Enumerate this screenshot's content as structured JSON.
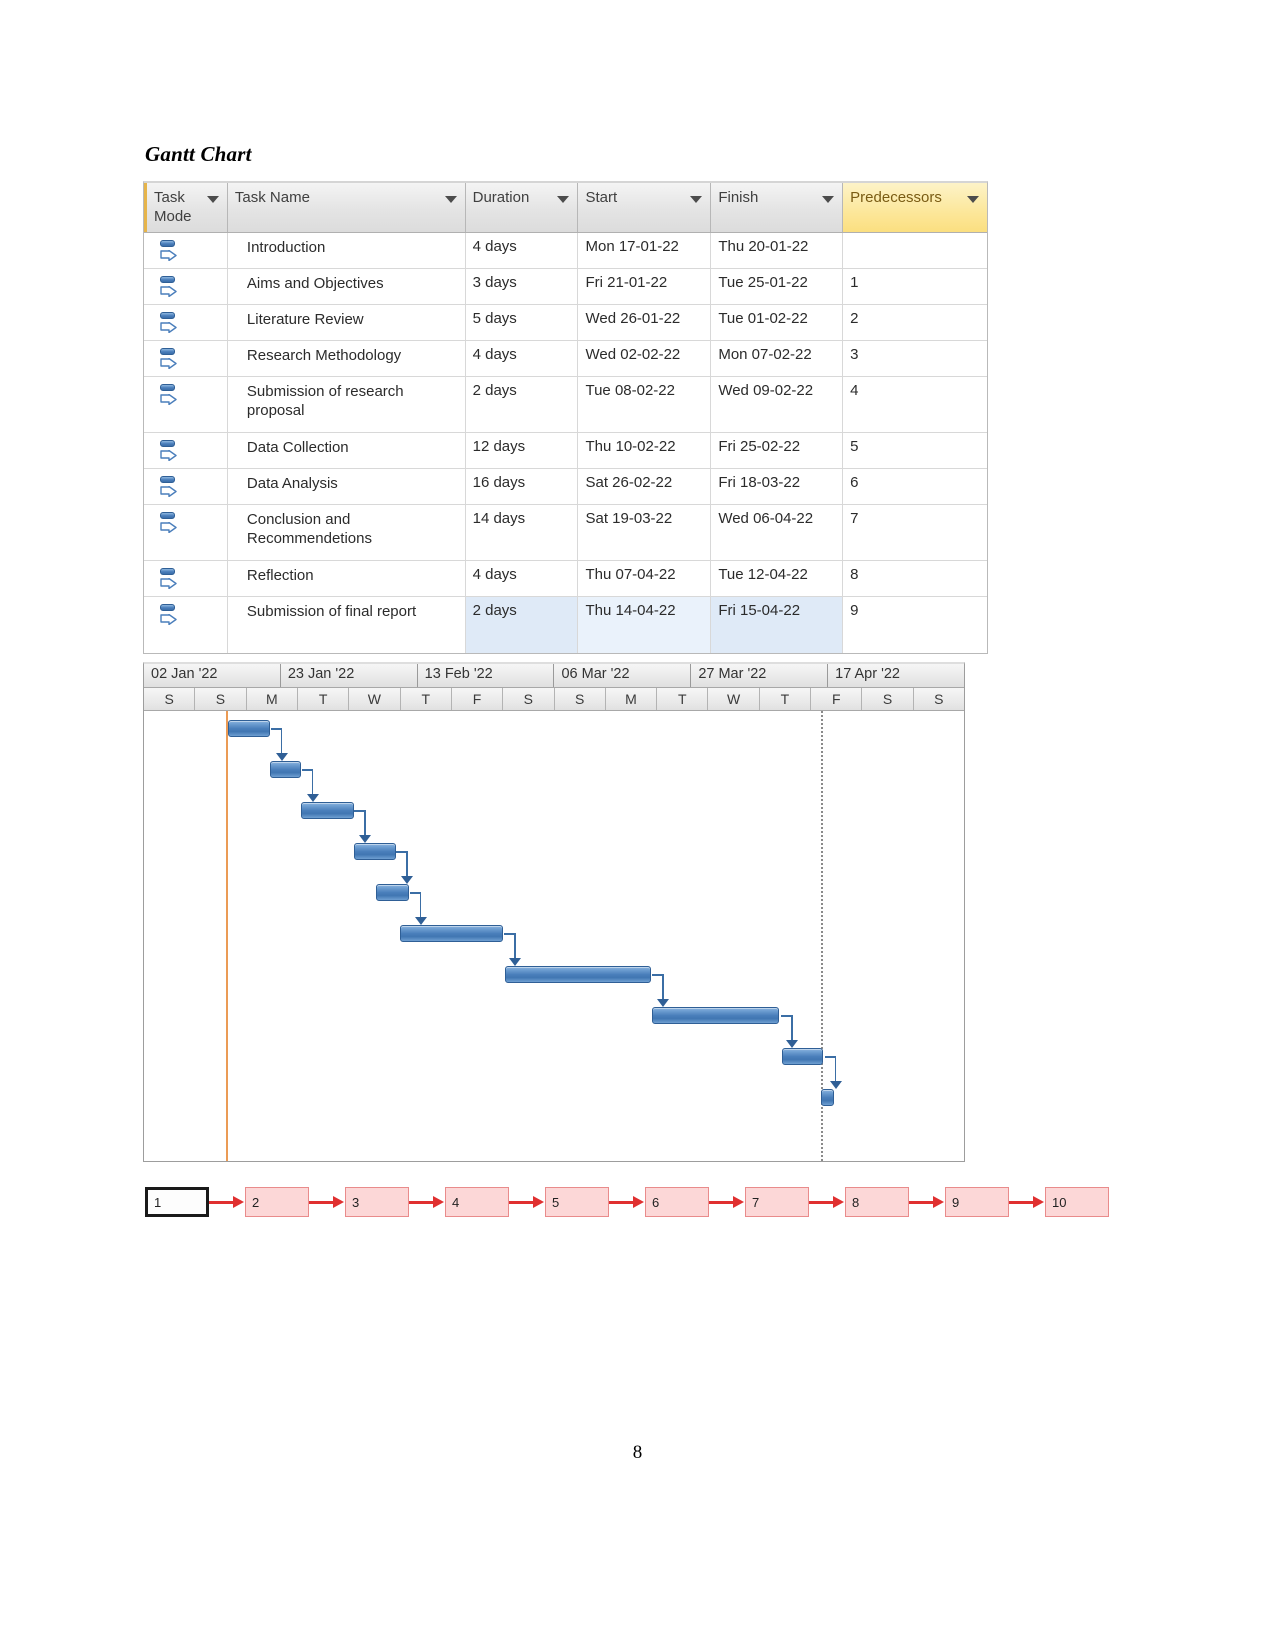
{
  "page": {
    "title": "Gantt Chart",
    "page_number": "8"
  },
  "table": {
    "columns": [
      {
        "key": "mode",
        "label": "Task Mode",
        "has_filter": true,
        "highlight": false
      },
      {
        "key": "name",
        "label": "Task Name",
        "has_filter": true,
        "highlight": false
      },
      {
        "key": "dur",
        "label": "Duration",
        "has_filter": true,
        "highlight": false
      },
      {
        "key": "start",
        "label": "Start",
        "has_filter": true,
        "highlight": false
      },
      {
        "key": "fin",
        "label": "Finish",
        "has_filter": true,
        "highlight": false
      },
      {
        "key": "pred",
        "label": "Predecessors",
        "has_filter": true,
        "highlight": true
      }
    ],
    "rows": [
      {
        "mode_icon": "auto-schedule-icon",
        "name": "Introduction",
        "duration": "4 days",
        "start": "Mon 17-01-22",
        "finish": "Thu 20-01-22",
        "predecessors": "",
        "tall": false,
        "selected": false
      },
      {
        "mode_icon": "auto-schedule-icon",
        "name": "Aims and Objectives",
        "duration": "3 days",
        "start": "Fri 21-01-22",
        "finish": "Tue 25-01-22",
        "predecessors": "1",
        "tall": false,
        "selected": false
      },
      {
        "mode_icon": "auto-schedule-icon",
        "name": "Literature Review",
        "duration": "5 days",
        "start": "Wed 26-01-22",
        "finish": "Tue 01-02-22",
        "predecessors": "2",
        "tall": false,
        "selected": false
      },
      {
        "mode_icon": "auto-schedule-icon",
        "name": "Research Methodology",
        "duration": "4 days",
        "start": "Wed 02-02-22",
        "finish": "Mon 07-02-22",
        "predecessors": "3",
        "tall": false,
        "selected": false
      },
      {
        "mode_icon": "auto-schedule-icon",
        "name": "Submission of research proposal",
        "duration": "2 days",
        "start": "Tue 08-02-22",
        "finish": "Wed 09-02-22",
        "predecessors": "4",
        "tall": true,
        "selected": false
      },
      {
        "mode_icon": "auto-schedule-icon",
        "name": "Data Collection",
        "duration": "12 days",
        "start": "Thu 10-02-22",
        "finish": "Fri 25-02-22",
        "predecessors": "5",
        "tall": false,
        "selected": false
      },
      {
        "mode_icon": "auto-schedule-icon",
        "name": "Data Analysis",
        "duration": "16 days",
        "start": "Sat 26-02-22",
        "finish": "Fri 18-03-22",
        "predecessors": "6",
        "tall": false,
        "selected": false
      },
      {
        "mode_icon": "auto-schedule-icon",
        "name": "Conclusion and Recommendetions",
        "duration": "14 days",
        "start": "Sat 19-03-22",
        "finish": "Wed 06-04-22",
        "predecessors": "7",
        "tall": true,
        "selected": false
      },
      {
        "mode_icon": "auto-schedule-icon",
        "name": "Reflection",
        "duration": "4 days",
        "start": "Thu 07-04-22",
        "finish": "Tue 12-04-22",
        "predecessors": "8",
        "tall": false,
        "selected": false
      },
      {
        "mode_icon": "auto-schedule-icon",
        "name": "Submission of final report",
        "duration": "2 days",
        "start": "Thu 14-04-22",
        "finish": "Fri 15-04-22",
        "predecessors": "9",
        "tall": true,
        "selected": true
      }
    ]
  },
  "chart_data": {
    "type": "bar",
    "title": "Gantt Chart",
    "xlabel": "",
    "ylabel": "",
    "timeline": {
      "week_headers": [
        "02 Jan '22",
        "23 Jan '22",
        "13 Feb '22",
        "06 Mar '22",
        "27 Mar '22",
        "17 Apr '22"
      ],
      "day_headers": [
        "S",
        "S",
        "M",
        "T",
        "W",
        "T",
        "F",
        "S",
        "S",
        "M",
        "T",
        "W",
        "T",
        "F",
        "S",
        "S"
      ],
      "range_start": "02 Jan '22",
      "range_end": "23 Apr '22",
      "today_line_color": "#eb9b55",
      "status_line_color": "#8a8a8a"
    },
    "categories": [
      "Introduction",
      "Aims and Objectives",
      "Literature Review",
      "Research Methodology",
      "Submission of research proposal",
      "Data Collection",
      "Data Analysis",
      "Conclusion and Recommendetions",
      "Reflection",
      "Submission of final report"
    ],
    "values": [
      4,
      3,
      5,
      4,
      2,
      12,
      16,
      14,
      4,
      2
    ],
    "ylabel_unit": "days",
    "bars": [
      {
        "task": "Introduction",
        "start": "Mon 17-01-22",
        "finish": "Thu 20-01-22",
        "duration_days": 4,
        "left_pct": 10.2,
        "width_pct": 5.2,
        "row": 0
      },
      {
        "task": "Aims and Objectives",
        "start": "Fri 21-01-22",
        "finish": "Tue 25-01-22",
        "duration_days": 3,
        "left_pct": 15.4,
        "width_pct": 3.8,
        "row": 1
      },
      {
        "task": "Literature Review",
        "start": "Wed 26-01-22",
        "finish": "Tue 01-02-22",
        "duration_days": 5,
        "left_pct": 19.2,
        "width_pct": 6.4,
        "row": 2
      },
      {
        "task": "Research Methodology",
        "start": "Wed 02-02-22",
        "finish": "Mon 07-02-22",
        "duration_days": 4,
        "left_pct": 25.6,
        "width_pct": 5.1,
        "row": 3
      },
      {
        "task": "Submission of research proposal",
        "start": "Tue 08-02-22",
        "finish": "Wed 09-02-22",
        "duration_days": 2,
        "left_pct": 28.3,
        "width_pct": 4.0,
        "row": 4
      },
      {
        "task": "Data Collection",
        "start": "Thu 10-02-22",
        "finish": "Fri 25-02-22",
        "duration_days": 12,
        "left_pct": 31.2,
        "width_pct": 12.6,
        "row": 5
      },
      {
        "task": "Data Analysis",
        "start": "Sat 26-02-22",
        "finish": "Fri 18-03-22",
        "duration_days": 16,
        "left_pct": 44.0,
        "width_pct": 17.8,
        "row": 6
      },
      {
        "task": "Conclusion and Recommendetions",
        "start": "Sat 19-03-22",
        "finish": "Wed 06-04-22",
        "duration_days": 14,
        "left_pct": 62.0,
        "width_pct": 15.5,
        "row": 7
      },
      {
        "task": "Reflection",
        "start": "Thu 07-04-22",
        "finish": "Tue 12-04-22",
        "duration_days": 4,
        "left_pct": 77.8,
        "width_pct": 5.0,
        "row": 8
      },
      {
        "task": "Submission of final report",
        "start": "Thu 14-04-22",
        "finish": "Fri 15-04-22",
        "duration_days": 2,
        "left_pct": 82.5,
        "width_pct": 1.6,
        "row": 9
      }
    ],
    "dependencies": [
      {
        "from": "Introduction",
        "to": "Aims and Objectives",
        "type": "FS"
      },
      {
        "from": "Aims and Objectives",
        "to": "Literature Review",
        "type": "FS"
      },
      {
        "from": "Literature Review",
        "to": "Research Methodology",
        "type": "FS"
      },
      {
        "from": "Research Methodology",
        "to": "Submission of research proposal",
        "type": "FS"
      },
      {
        "from": "Submission of research proposal",
        "to": "Data Collection",
        "type": "FS"
      },
      {
        "from": "Data Collection",
        "to": "Data Analysis",
        "type": "FS"
      },
      {
        "from": "Data Analysis",
        "to": "Conclusion and Recommendetions",
        "type": "FS"
      },
      {
        "from": "Conclusion and Recommendetions",
        "to": "Reflection",
        "type": "FS"
      },
      {
        "from": "Reflection",
        "to": "Submission of final report",
        "type": "FS"
      }
    ],
    "bar_color": "#4a7fbb",
    "bar_border_color": "#2f5f96",
    "link_color": "#3b6ea5"
  },
  "flow": {
    "boxes": [
      {
        "label": "1",
        "selected": true
      },
      {
        "label": "2",
        "selected": false
      },
      {
        "label": "3",
        "selected": false
      },
      {
        "label": "4",
        "selected": false
      },
      {
        "label": "5",
        "selected": false
      },
      {
        "label": "6",
        "selected": false
      },
      {
        "label": "7",
        "selected": false
      },
      {
        "label": "8",
        "selected": false
      },
      {
        "label": "9",
        "selected": false
      },
      {
        "label": "10",
        "selected": false
      }
    ],
    "box_fill": "#fcd7d7",
    "box_border": "#e98b8b",
    "arrow_color": "#e03030"
  }
}
